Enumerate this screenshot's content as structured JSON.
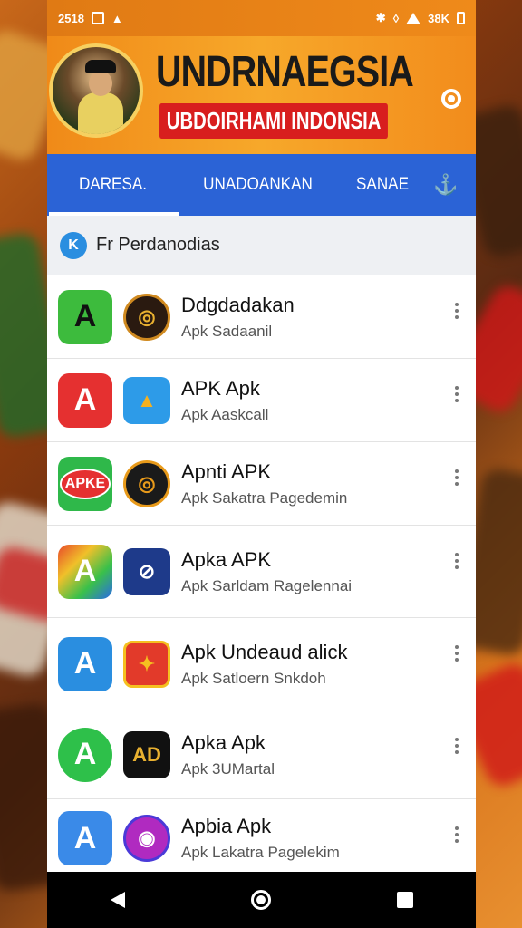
{
  "status_bar": {
    "time": "2518",
    "battery": "38K"
  },
  "banner": {
    "title": "UNDRNAEGSIA",
    "subtitle": "UBDOIRHAMI INDONSIA"
  },
  "tabs": [
    {
      "label": "DARESA."
    },
    {
      "label": "UNADOANKAN"
    },
    {
      "label": "SANAE"
    }
  ],
  "section": {
    "label": "Fr Perdanodias"
  },
  "apps": [
    {
      "title": "Ddgdadakan",
      "subtitle": "Apk Sadaanil",
      "icon_glyph": "A",
      "icon_color": "#3dbb3d",
      "badge_glyph": "◎",
      "badge_color": "#2a1a10"
    },
    {
      "title": "APK Apk",
      "subtitle": "Apk Aaskcall",
      "icon_glyph": "A",
      "icon_color": "#e53030",
      "badge_glyph": "▲",
      "badge_color": "#2d9be8"
    },
    {
      "title": "Apnti APK",
      "subtitle": "Apk Sakatra Pagedemin",
      "icon_glyph": "APKE",
      "icon_color": "#2fb84a",
      "badge_glyph": "◎",
      "badge_color": "#e89a1a"
    },
    {
      "title": "Apka APK",
      "subtitle": "Apk Sarldam Ragelennai",
      "icon_glyph": "A",
      "icon_color": "#4a6ad8",
      "badge_glyph": "⊘",
      "badge_color": "#1e3a8a"
    },
    {
      "title": "Apk Undeaud alick",
      "subtitle": "Apk Satloern Snkdoh",
      "icon_glyph": "A",
      "icon_color": "#2a8ee0",
      "badge_glyph": "✦",
      "badge_color": "#e23a2a"
    },
    {
      "title": "Apka Apk",
      "subtitle": "Apk 3UMartal",
      "icon_glyph": "A",
      "icon_color": "#2ec04a",
      "badge_glyph": "AD",
      "badge_color": "#111111"
    },
    {
      "title": "Apbia Apk",
      "subtitle": "Apk Lakatra Pagelekim",
      "icon_glyph": "A",
      "icon_color": "#3a8ae8",
      "badge_glyph": "◉",
      "badge_color": "#b02ac0"
    }
  ]
}
